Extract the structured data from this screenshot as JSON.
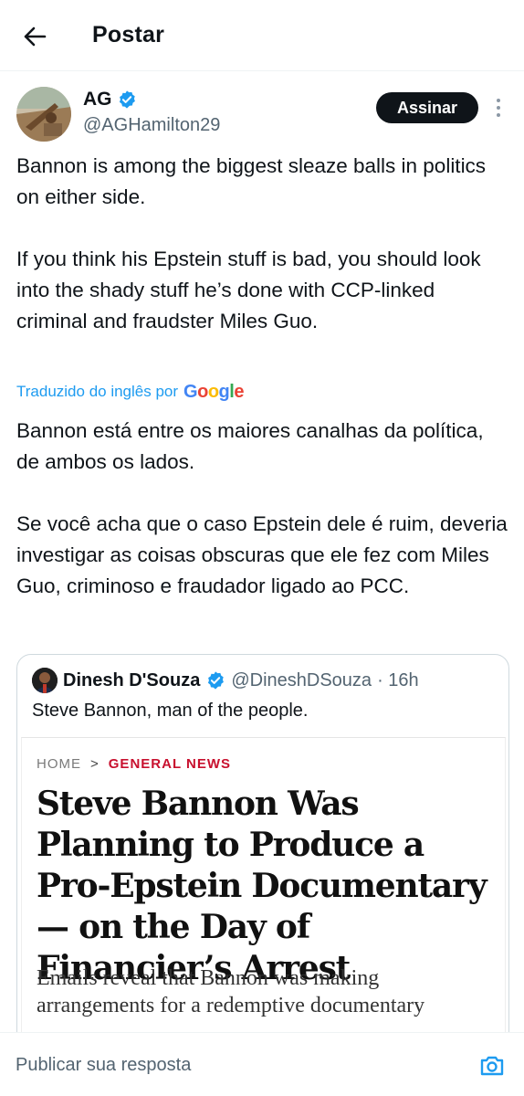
{
  "header": {
    "title": "Postar",
    "back_icon": "arrow-left-icon"
  },
  "author": {
    "name": "AG",
    "handle": "@AGHamilton29",
    "verified_icon": "verified-badge-icon",
    "subscribe_label": "Assinar",
    "more_icon": "more-vertical-icon"
  },
  "tweet": {
    "original": "Bannon is among the biggest sleaze balls in politics on either side.\n\nIf you think his Epstein stuff is bad, you should look into the shady stuff he’s done with CCP-linked criminal and fraudster Miles Guo.",
    "translation_label": "Traduzido do inglês por",
    "translation_provider": "Google",
    "translated": "Bannon está entre os maiores canalhas da política, de ambos os lados.\n\nSe você acha que o caso Epstein dele é ruim, deveria investigar as coisas obscuras que ele fez com Miles Guo, criminoso e fraudador ligado ao PCC."
  },
  "quote": {
    "name": "Dinesh D'Souza",
    "handle": "@DineshDSouza",
    "time": "· 16h",
    "text": "Steve Bannon, man of the people.",
    "article": {
      "crumb_home": "HOME",
      "crumb_sep": ">",
      "crumb_section": "GENERAL NEWS",
      "headline": "Steve Bannon Was Planning to Produce a Pro-Epstein Documentary — on the Day of Financier’s Arrest",
      "dek": "Emails reveal that Bannon was making arrangements for a redemptive documentary"
    }
  },
  "reply": {
    "placeholder": "Publicar sua resposta",
    "camera_icon": "camera-icon"
  },
  "colors": {
    "accent": "#1d9bf0",
    "text": "#0f1419",
    "muted": "#536471",
    "news_red": "#c8102e"
  }
}
